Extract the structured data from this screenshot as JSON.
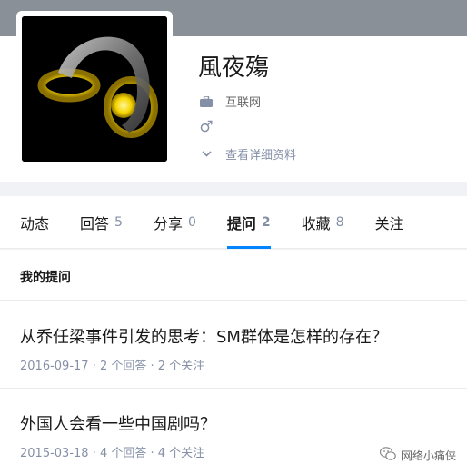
{
  "profile": {
    "name": "風夜殤",
    "industry": "互联网",
    "gender_symbol": "♂",
    "detail_link": "查看详细资料",
    "avatar_icon": "golden-rings-avatar"
  },
  "tabs": [
    {
      "label": "动态",
      "count": ""
    },
    {
      "label": "回答",
      "count": "5"
    },
    {
      "label": "分享",
      "count": "0"
    },
    {
      "label": "提问",
      "count": "2"
    },
    {
      "label": "收藏",
      "count": "8"
    },
    {
      "label": "关注",
      "count": ""
    }
  ],
  "active_tab": "提问",
  "section": {
    "title": "我的提问"
  },
  "questions": [
    {
      "title": "从乔任梁事件引发的思考：SM群体是怎样的存在？",
      "date": "2016-09-17",
      "answers": "2 个回答",
      "follows": "2 个关注"
    },
    {
      "title": "外国人会看一些中国剧吗？",
      "date": "2015-03-18",
      "answers": "4 个回答",
      "follows": "4 个关注"
    }
  ],
  "meta_separator": " · ",
  "watermark": {
    "text": "网络小痛侠",
    "icon": "wechat-icon"
  },
  "colors": {
    "accent": "#0084ff",
    "muted": "#8590a6",
    "cover": "#8a9097"
  }
}
